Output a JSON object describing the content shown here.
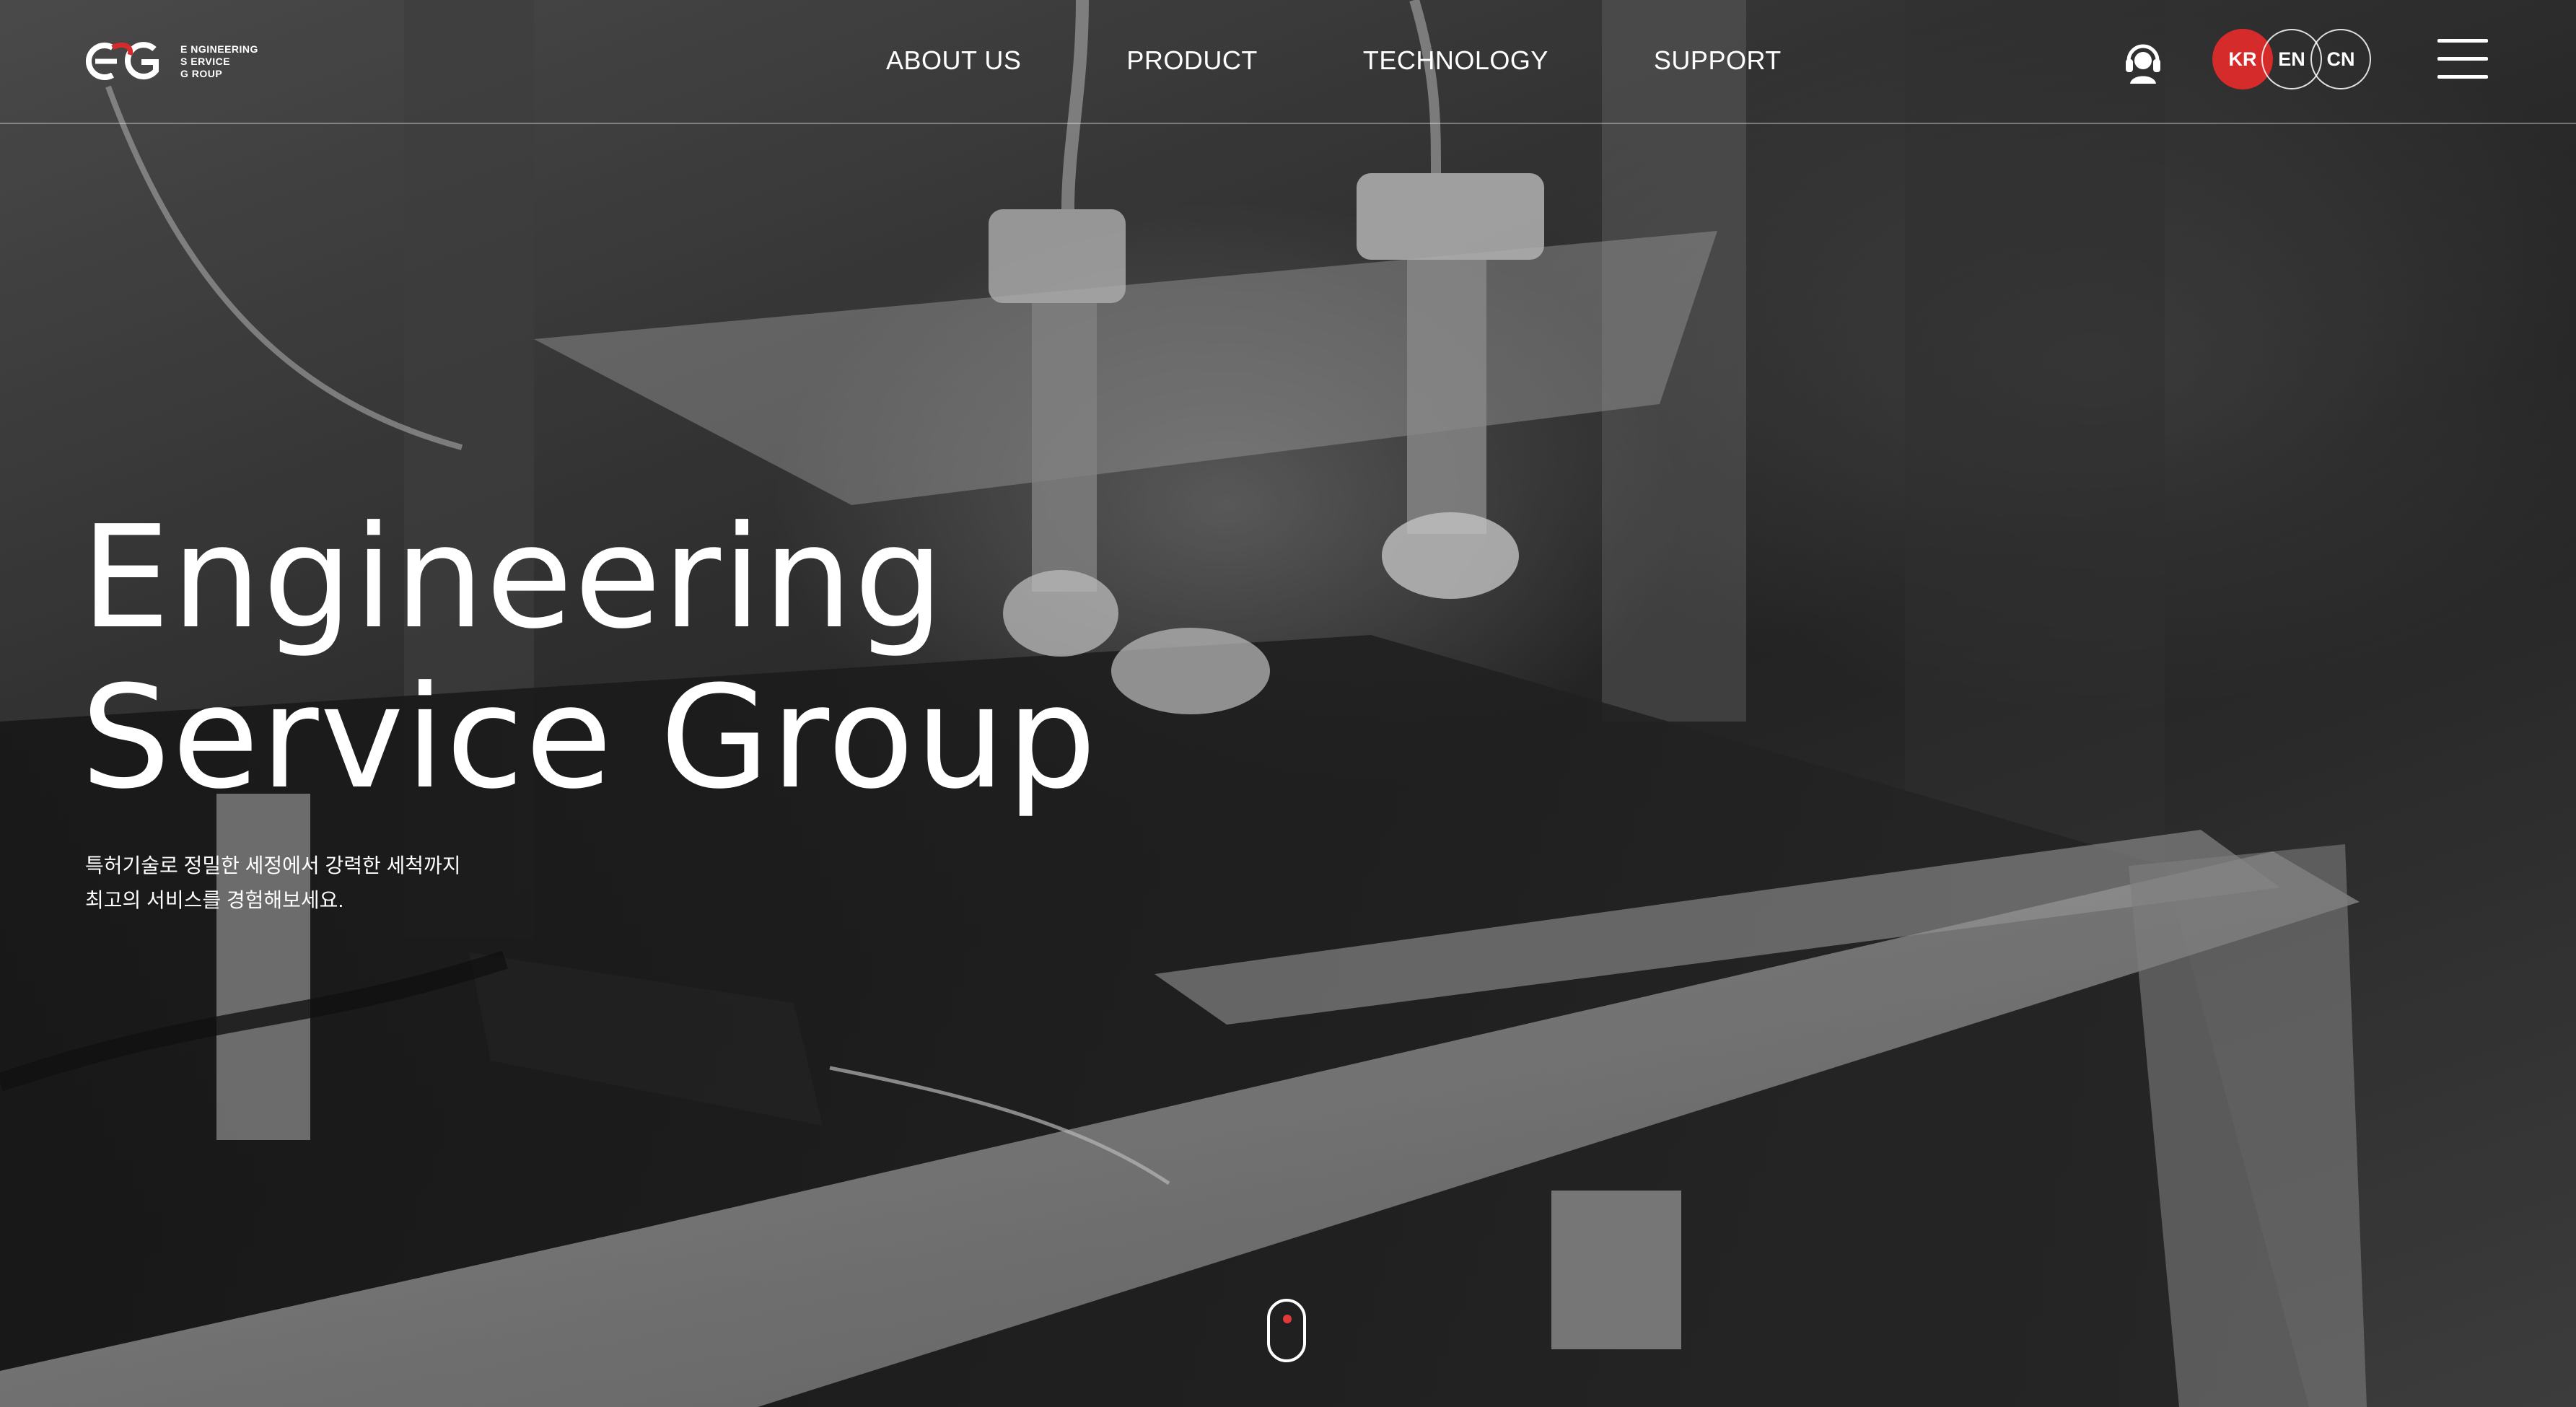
{
  "logo": {
    "mark": "EG",
    "line1": "E NGINEERING",
    "line2": "S ERVICE",
    "line3": "G ROUP",
    "accent_color": "#d62b2b"
  },
  "nav": {
    "items": [
      {
        "label": "ABOUT US"
      },
      {
        "label": "PRODUCT"
      },
      {
        "label": "TECHNOLOGY"
      },
      {
        "label": "SUPPORT"
      }
    ]
  },
  "header_actions": {
    "support_icon": "headset-icon",
    "languages": [
      {
        "code": "KR",
        "active": true
      },
      {
        "code": "EN",
        "active": false
      },
      {
        "code": "CN",
        "active": false
      }
    ],
    "menu_icon": "hamburger-menu-icon"
  },
  "hero": {
    "title_line1": "Engineering",
    "title_line2": "Service Group",
    "subtitle_line1": "특허기술로 정밀한 세정에서 강력한 세척까지",
    "subtitle_line2": "최고의 서비스를 경험해보세요."
  },
  "scroll": {
    "icon": "scroll-mouse-icon",
    "dot_color": "#e23a3a"
  }
}
